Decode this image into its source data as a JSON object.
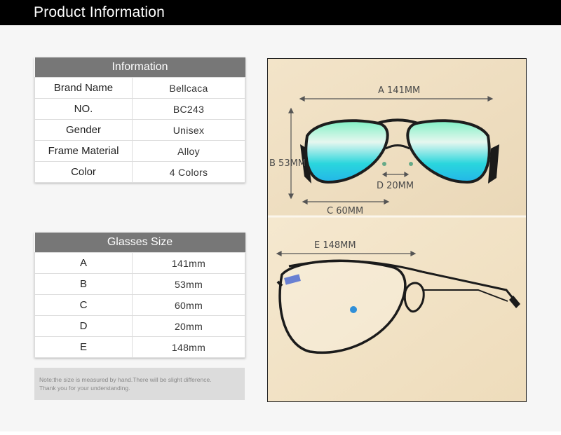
{
  "header": {
    "title": "Product Information"
  },
  "info_table": {
    "title": "Information",
    "rows": [
      {
        "label": "Brand Name",
        "value": "Bellcaca"
      },
      {
        "label": "NO.",
        "value": "BC243"
      },
      {
        "label": "Gender",
        "value": "Unisex"
      },
      {
        "label": "Frame Material",
        "value": "Alloy"
      },
      {
        "label": "Color",
        "value": "4 Colors"
      }
    ]
  },
  "size_table": {
    "title": "Glasses Size",
    "rows": [
      {
        "label": "A",
        "value": "141mm"
      },
      {
        "label": "B",
        "value": "53mm"
      },
      {
        "label": "C",
        "value": "60mm"
      },
      {
        "label": "D",
        "value": "20mm"
      },
      {
        "label": "E",
        "value": "148mm"
      }
    ]
  },
  "note": {
    "line1": "Note:the size is measured by hand.There will be slight difference.",
    "line2": "Thank you for your understanding."
  },
  "dimensions": {
    "a": "A 141MM",
    "b": "B 53MM",
    "c": "C 60MM",
    "d": "D 20MM",
    "e": "E 148MM"
  }
}
